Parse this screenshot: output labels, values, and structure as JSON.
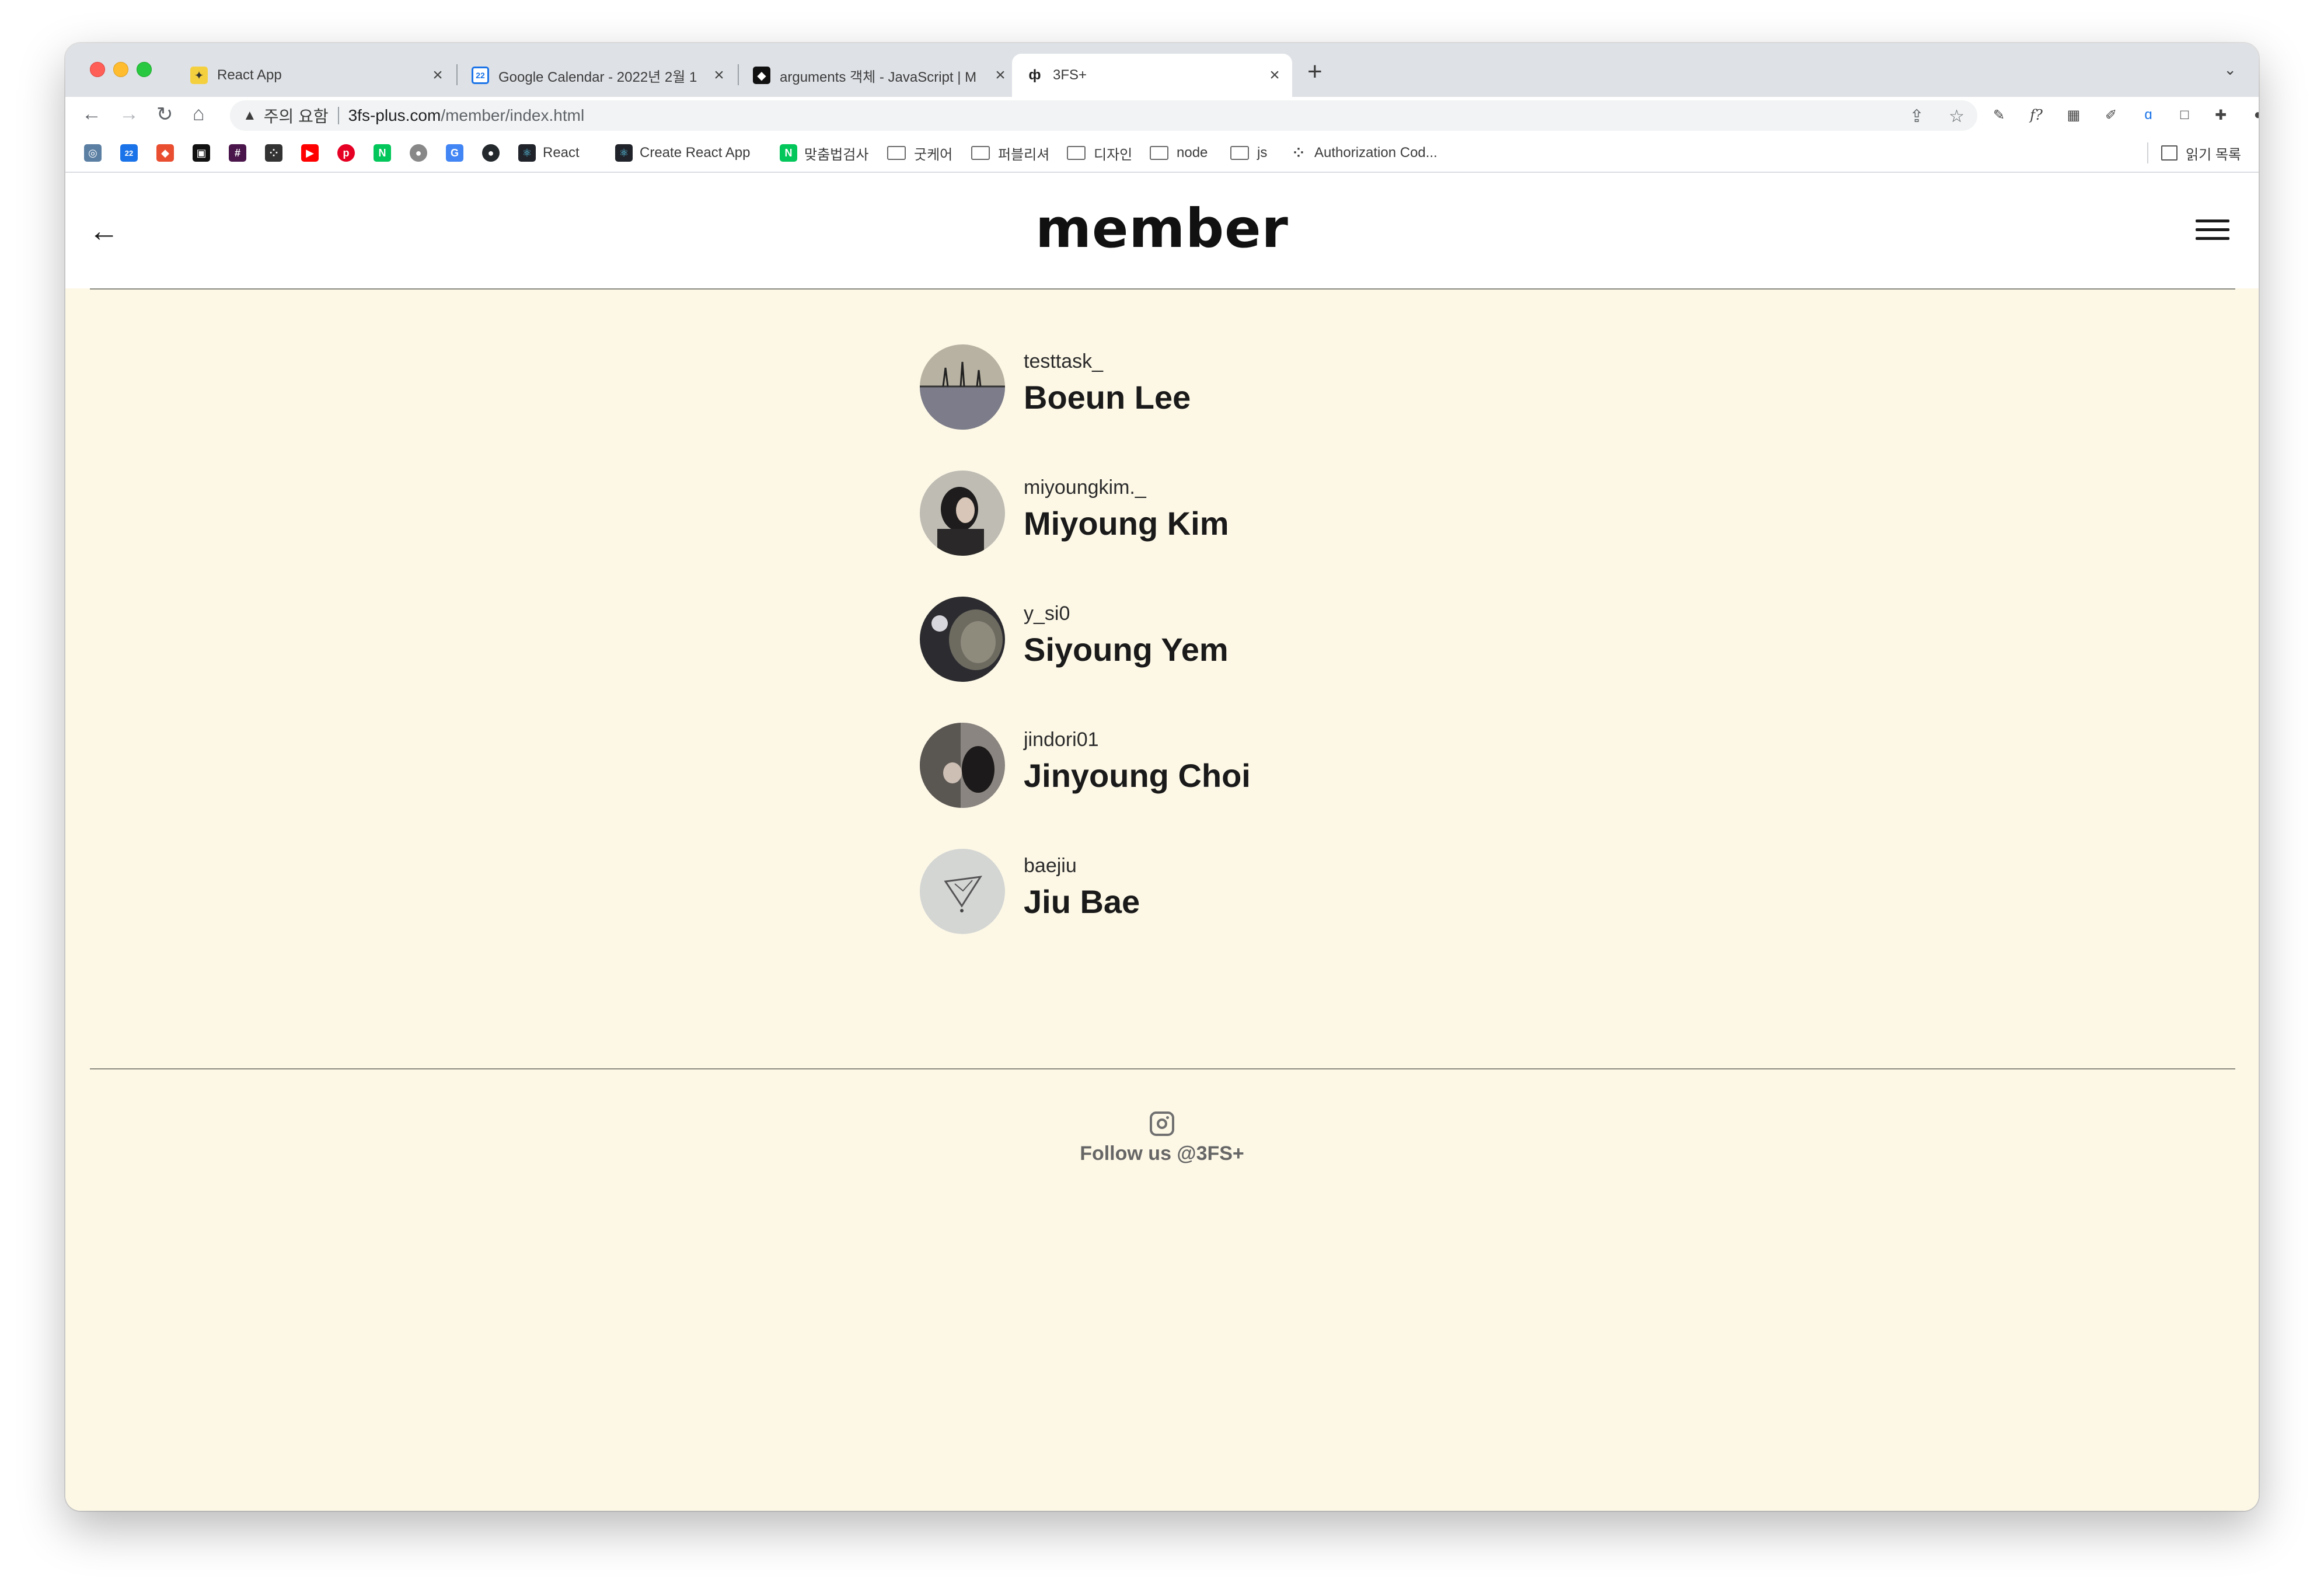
{
  "browser": {
    "tabs": [
      {
        "title": "React App",
        "favicon": "react-app-icon",
        "active": false
      },
      {
        "title": "Google Calendar - 2022년 2월 1",
        "favicon": "google-calendar-icon",
        "active": false
      },
      {
        "title": "arguments 객체 - JavaScript | M",
        "favicon": "mdn-icon",
        "active": false
      },
      {
        "title": "3FS+",
        "favicon": "site-icon",
        "active": true
      }
    ],
    "address": {
      "security_label": "주의 요함",
      "domain": "3fs-plus.com",
      "path": "/member/index.html"
    },
    "bookmarks": [
      {
        "label": "React",
        "icon": "react-icon"
      },
      {
        "label": "Create React App",
        "icon": "cra-icon"
      },
      {
        "label": "맞춤법검사",
        "icon": "naver-icon"
      },
      {
        "label": "굿케어",
        "icon": "folder-icon"
      },
      {
        "label": "퍼블리셔",
        "icon": "folder-icon"
      },
      {
        "label": "디자인",
        "icon": "folder-icon"
      },
      {
        "label": "node",
        "icon": "folder-icon"
      },
      {
        "label": "js",
        "icon": "folder-icon"
      },
      {
        "label": "Authorization Cod...",
        "icon": "bookmark-icon"
      }
    ],
    "reading_list": "읽기 목록"
  },
  "page": {
    "title": "member",
    "members": [
      {
        "handle": "testtask_",
        "name": "Boeun Lee"
      },
      {
        "handle": "miyoungkim._",
        "name": "Miyoung Kim"
      },
      {
        "handle": "y_si0",
        "name": "Siyoung Yem"
      },
      {
        "handle": "jindori01",
        "name": "Jinyoung Choi"
      },
      {
        "handle": "baejiu",
        "name": "Jiu Bae"
      }
    ],
    "footer": {
      "follow_text": "Follow us @3FS+"
    }
  },
  "colors": {
    "page_background": "#fdf8e6",
    "header_background": "#ffffff",
    "tabstrip": "#dee1e6"
  }
}
